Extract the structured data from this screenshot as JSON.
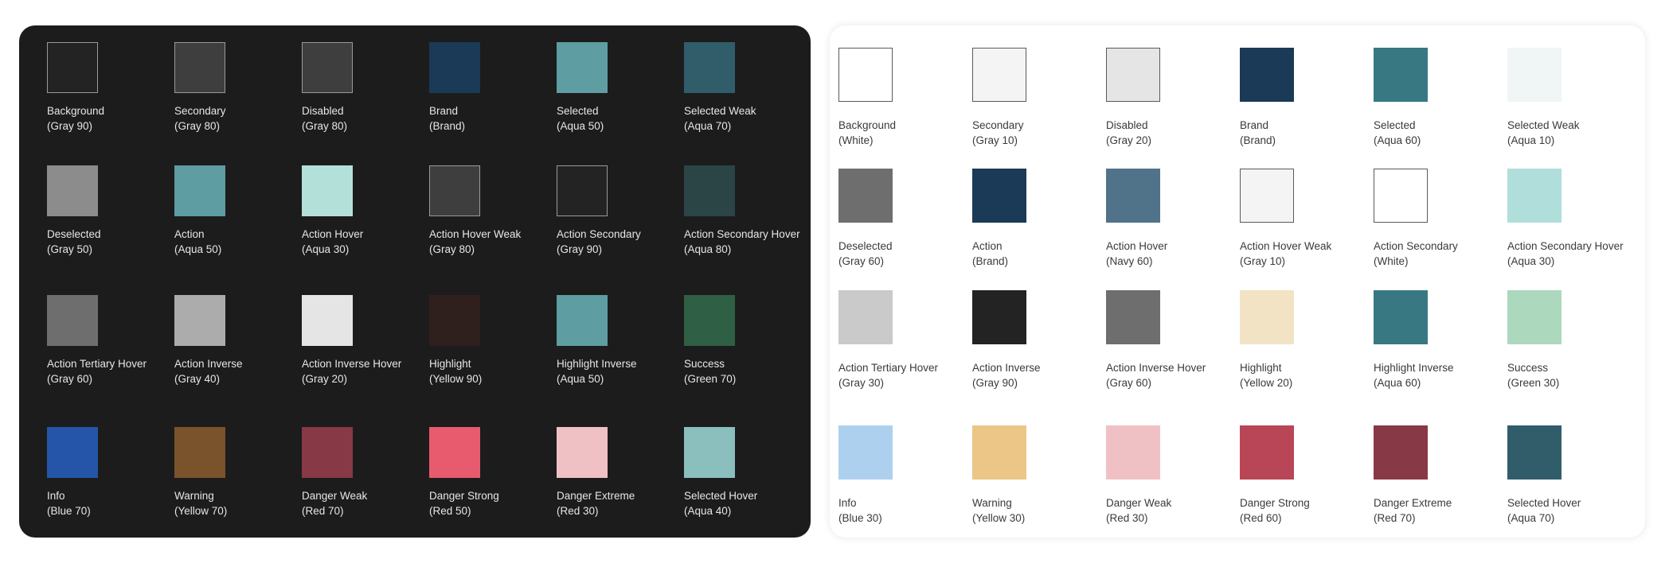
{
  "dark_theme": {
    "tokens": [
      {
        "name": "Background",
        "value": "(Gray 90)",
        "color": "#232323",
        "border": true
      },
      {
        "name": "Secondary",
        "value": "(Gray 80)",
        "color": "#3e3e3e",
        "border": true
      },
      {
        "name": "Disabled",
        "value": "(Gray 80)",
        "color": "#3e3e3e",
        "border": true
      },
      {
        "name": "Brand",
        "value": "(Brand)",
        "color": "#1a3a57",
        "border": false
      },
      {
        "name": "Selected",
        "value": "(Aqua 50)",
        "color": "#5e9da1",
        "border": false
      },
      {
        "name": "Selected Weak",
        "value": "(Aqua 70)",
        "color": "#315d6b",
        "border": false
      },
      {
        "name": "Deselected",
        "value": "(Gray 50)",
        "color": "#8c8c8c",
        "border": false
      },
      {
        "name": "Action",
        "value": "(Aqua 50)",
        "color": "#5e9da1",
        "border": false
      },
      {
        "name": "Action Hover",
        "value": "(Aqua 30)",
        "color": "#b4e0da",
        "border": false
      },
      {
        "name": "Action Hover Weak",
        "value": "(Gray 80)",
        "color": "#3e3e3e",
        "border": true
      },
      {
        "name": "Action Secondary",
        "value": "(Gray 90)",
        "color": "#232323",
        "border": true
      },
      {
        "name": "Action Secondary Hover",
        "value": "(Aqua 80)",
        "color": "#2b4446",
        "border": false
      },
      {
        "name": "Action Tertiary Hover",
        "value": "(Gray 60)",
        "color": "#6e6e6e",
        "border": false
      },
      {
        "name": "Action Inverse",
        "value": "(Gray 40)",
        "color": "#acacac",
        "border": false
      },
      {
        "name": "Action Inverse Hover",
        "value": "(Gray 20)",
        "color": "#e5e5e5",
        "border": false
      },
      {
        "name": "Highlight",
        "value": "(Yellow 90)",
        "color": "#2f1f1d",
        "border": false
      },
      {
        "name": "Highlight Inverse",
        "value": "(Aqua 50)",
        "color": "#5e9da1",
        "border": false
      },
      {
        "name": "Success",
        "value": "(Green 70)",
        "color": "#2f5f44",
        "border": false
      },
      {
        "name": "Info",
        "value": "(Blue 70)",
        "color": "#2455a8",
        "border": false
      },
      {
        "name": "Warning",
        "value": "(Yellow 70)",
        "color": "#7a522b",
        "border": false
      },
      {
        "name": "Danger Weak",
        "value": "(Red 70)",
        "color": "#873946",
        "border": false
      },
      {
        "name": "Danger Strong",
        "value": "(Red 50)",
        "color": "#e85a6e",
        "border": false
      },
      {
        "name": "Danger Extreme",
        "value": "(Red 30)",
        "color": "#f0c1c4",
        "border": false
      },
      {
        "name": "Selected Hover",
        "value": "(Aqua 40)",
        "color": "#8abfbe",
        "border": false
      }
    ]
  },
  "light_theme": {
    "tokens": [
      {
        "name": "Background",
        "value": "(White)",
        "color": "#ffffff",
        "border": true
      },
      {
        "name": "Secondary",
        "value": "(Gray 10)",
        "color": "#f4f4f4",
        "border": true
      },
      {
        "name": "Disabled",
        "value": "(Gray 20)",
        "color": "#e5e5e5",
        "border": true
      },
      {
        "name": "Brand",
        "value": "(Brand)",
        "color": "#1a3a57",
        "border": false
      },
      {
        "name": "Selected",
        "value": "(Aqua 60)",
        "color": "#387883",
        "border": false
      },
      {
        "name": "Selected Weak",
        "value": "(Aqua 10)",
        "color": "#f0f6f5",
        "border": false
      },
      {
        "name": "Deselected",
        "value": "(Gray 60)",
        "color": "#6e6e6e",
        "border": false
      },
      {
        "name": "Action",
        "value": "(Brand)",
        "color": "#1a3a57",
        "border": false
      },
      {
        "name": "Action Hover",
        "value": "(Navy 60)",
        "color": "#50738a",
        "border": false
      },
      {
        "name": "Action Hover Weak",
        "value": "(Gray 10)",
        "color": "#f4f4f4",
        "border": true
      },
      {
        "name": "Action Secondary",
        "value": "(White)",
        "color": "#ffffff",
        "border": true
      },
      {
        "name": "Action Secondary Hover",
        "value": "(Aqua 30)",
        "color": "#b0dedb",
        "border": false
      },
      {
        "name": "Action Tertiary Hover",
        "value": "(Gray 30)",
        "color": "#cacaca",
        "border": false
      },
      {
        "name": "Action Inverse",
        "value": "(Gray 90)",
        "color": "#232323",
        "border": false
      },
      {
        "name": "Action Inverse Hover",
        "value": "(Gray 60)",
        "color": "#6e6e6e",
        "border": false
      },
      {
        "name": "Highlight",
        "value": "(Yellow 20)",
        "color": "#f2e3c5",
        "border": false
      },
      {
        "name": "Highlight Inverse",
        "value": "(Aqua 60)",
        "color": "#387883",
        "border": false
      },
      {
        "name": "Success",
        "value": "(Green 30)",
        "color": "#acd8bd",
        "border": false
      },
      {
        "name": "Info",
        "value": "(Blue 30)",
        "color": "#aed0ef",
        "border": false
      },
      {
        "name": "Warning",
        "value": "(Yellow 30)",
        "color": "#ebc686",
        "border": false
      },
      {
        "name": "Danger Weak",
        "value": "(Red 30)",
        "color": "#f0c1c4",
        "border": false
      },
      {
        "name": "Danger Strong",
        "value": "(Red 60)",
        "color": "#b84656",
        "border": false
      },
      {
        "name": "Danger Extreme",
        "value": "(Red 70)",
        "color": "#873946",
        "border": false
      },
      {
        "name": "Selected Hover",
        "value": "(Aqua 70)",
        "color": "#315d6b",
        "border": false
      }
    ]
  }
}
